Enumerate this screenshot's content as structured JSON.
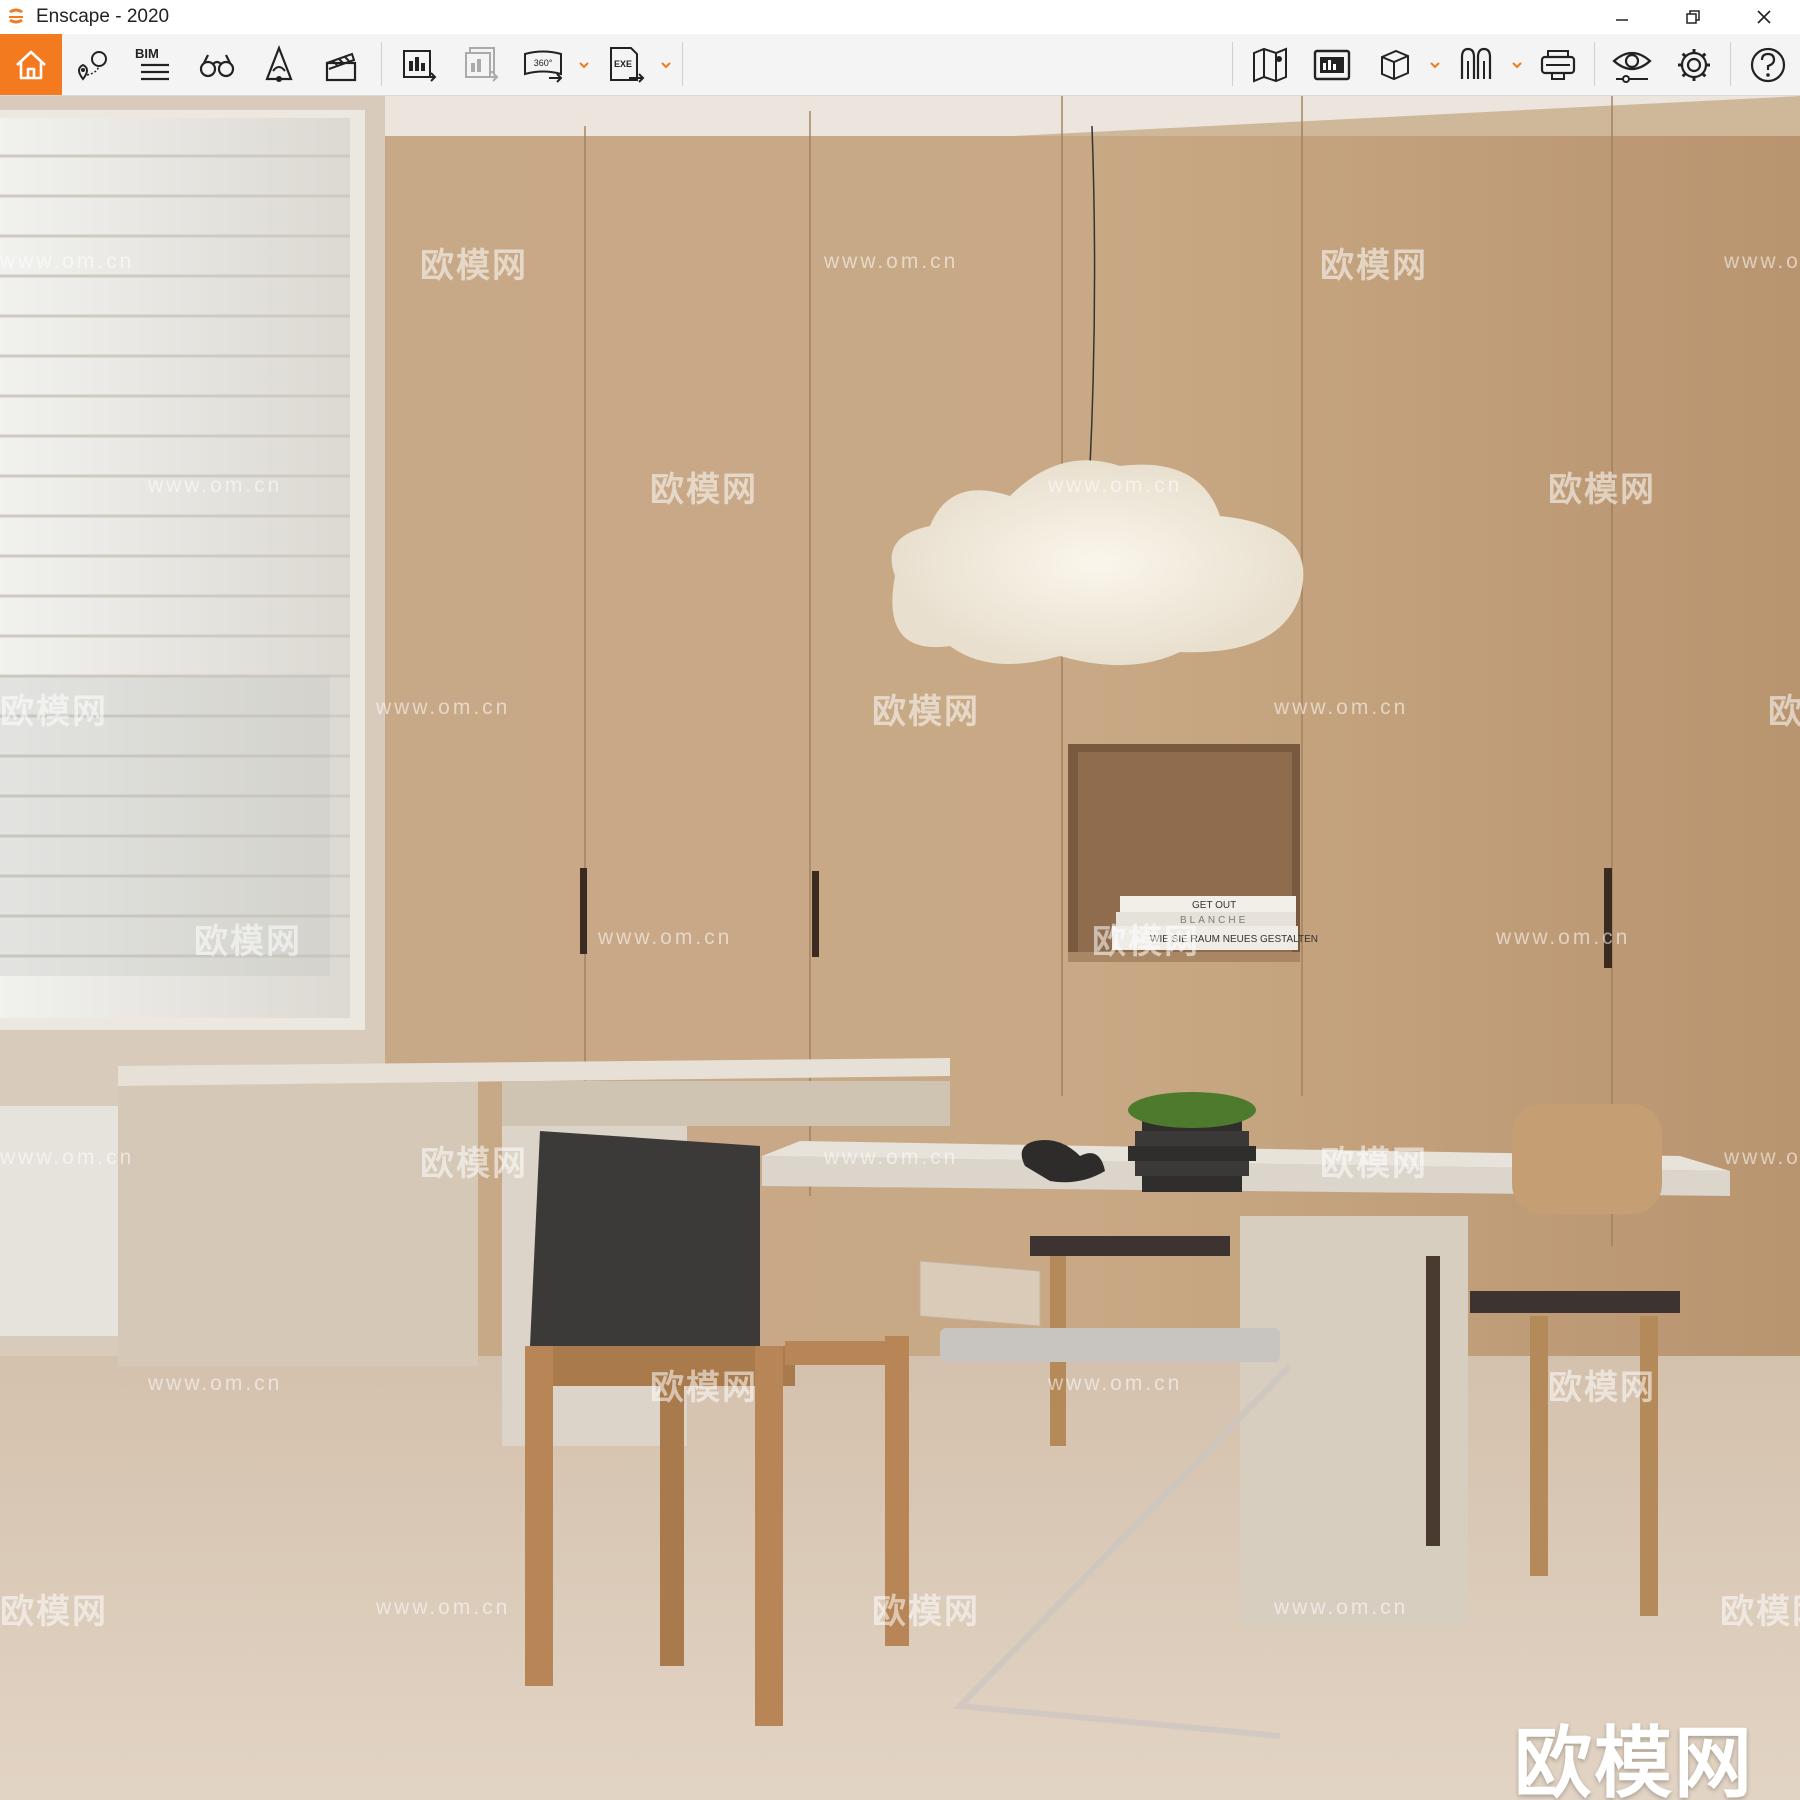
{
  "window": {
    "title": "Enscape - 2020",
    "controls": [
      "minimize-icon",
      "restore-icon",
      "close-icon"
    ]
  },
  "toolbar": {
    "accent_color": "#f47a1f",
    "left_group": [
      {
        "name": "home-icon",
        "active": true
      },
      {
        "name": "views-pin-icon"
      },
      {
        "name": "bim-icon",
        "label": "BIM"
      },
      {
        "name": "binoculars-icon"
      },
      {
        "name": "lighting-icon"
      },
      {
        "name": "clapperboard-icon"
      }
    ],
    "export_group": [
      {
        "name": "render-export-icon"
      },
      {
        "name": "batch-render-icon"
      },
      {
        "name": "panorama-360-icon",
        "label": "360°",
        "has_dropdown": true
      },
      {
        "name": "exe-export-icon",
        "label": "EXE",
        "has_dropdown": true
      }
    ],
    "right_group": [
      {
        "name": "map-icon"
      },
      {
        "name": "minimap-icon"
      },
      {
        "name": "cube-view-icon",
        "has_dropdown": true
      },
      {
        "name": "asset-library-icon",
        "has_dropdown": true
      },
      {
        "name": "vr-headset-icon"
      },
      {
        "name": "visual-settings-icon"
      },
      {
        "name": "gear-icon"
      },
      {
        "name": "help-icon"
      }
    ]
  },
  "viewport": {
    "watermarks": {
      "brand": "欧模网",
      "url": "www.om.cn"
    },
    "corner_brand": "欧模网",
    "books": [
      "GET OUT",
      "BLANCHE",
      "WIE SIE RAUM NEUES GESTALTEN"
    ]
  }
}
